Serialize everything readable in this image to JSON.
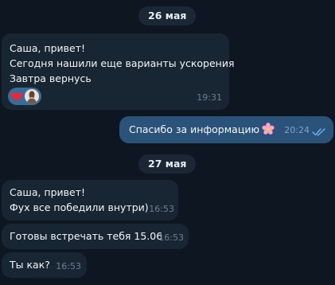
{
  "dates": [
    "26 мая",
    "27 мая"
  ],
  "messages": [
    {
      "direction": "in",
      "lines": [
        "Саша, привет!",
        "Сегодня нашили еще варианты ускорения",
        "Завтра вернусь"
      ],
      "time": "19:31",
      "reactions": [
        "red-heart-icon",
        "user-avatar"
      ]
    },
    {
      "direction": "out",
      "text": "Спасибо за информацию",
      "emoji": "cherry-blossom-icon",
      "time": "20:24",
      "status": "read"
    },
    {
      "direction": "in",
      "lines": [
        "Саша, привет!",
        "Фух все победили внутри)"
      ],
      "time": "16:53"
    },
    {
      "direction": "in",
      "text": "Готовы встречать тебя 15.06",
      "time": "16:53"
    },
    {
      "direction": "in",
      "text": "Ты как?",
      "time": "16:53"
    }
  ],
  "colors": {
    "background": "#0e1621",
    "incoming_bubble": "#182533",
    "outgoing_bubble": "#2b5278",
    "date_pill": "#1b2734",
    "read_check": "#6ab3f3"
  }
}
